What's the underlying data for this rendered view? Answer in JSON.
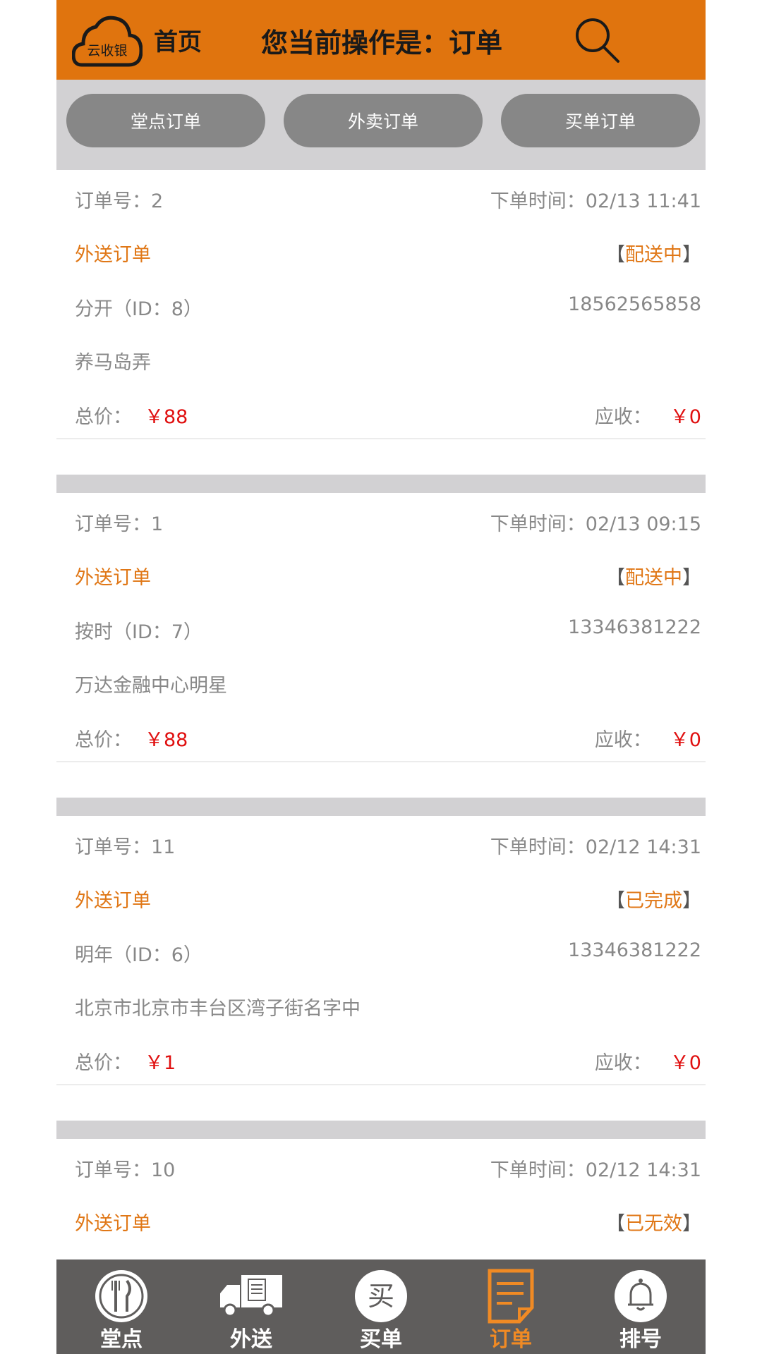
{
  "header": {
    "logo_text": "云收银",
    "home_label": "首页",
    "title": "您当前操作是：订单"
  },
  "tabs": [
    {
      "label": "堂点订单"
    },
    {
      "label": "外卖订单"
    },
    {
      "label": "买单订单"
    }
  ],
  "labels": {
    "order_no": "订单号：",
    "order_time": "下单时间：",
    "total": "总价：",
    "receivable": "应收："
  },
  "orders": [
    {
      "order_no": "2",
      "time": "02/13 11:41",
      "type": "外送订单",
      "status": "配送中",
      "customer": "分开（ID：8）",
      "phone": "18562565858",
      "address": "养马岛弄",
      "total": "￥88",
      "receivable": "￥0"
    },
    {
      "order_no": "1",
      "time": "02/13 09:15",
      "type": "外送订单",
      "status": "配送中",
      "customer": "按时（ID：7）",
      "phone": "13346381222",
      "address": "万达金融中心明星",
      "total": "￥88",
      "receivable": "￥0"
    },
    {
      "order_no": "11",
      "time": "02/12 14:31",
      "type": "外送订单",
      "status": "已完成",
      "customer": "明年（ID：6）",
      "phone": "13346381222",
      "address": "北京市北京市丰台区湾子街名字中",
      "total": "￥1",
      "receivable": "￥0"
    },
    {
      "order_no": "10",
      "time": "02/12 14:31",
      "type": "外送订单",
      "status": "已无效"
    }
  ],
  "bottom_nav": [
    {
      "label": "堂点",
      "icon": "fork-knife-icon"
    },
    {
      "label": "外送",
      "icon": "delivery-truck-icon"
    },
    {
      "label": "买单",
      "icon": "buy-icon",
      "icon_text": "买"
    },
    {
      "label": "订单",
      "icon": "order-document-icon",
      "active": true
    },
    {
      "label": "排号",
      "icon": "bell-icon"
    }
  ],
  "colors": {
    "header_bg": "#e0740e",
    "accent_orange": "#e07716",
    "price_red": "#e00f0f",
    "nav_bg": "#5f5d5c",
    "nav_active": "#f08a24",
    "tab_bg": "#878787"
  }
}
